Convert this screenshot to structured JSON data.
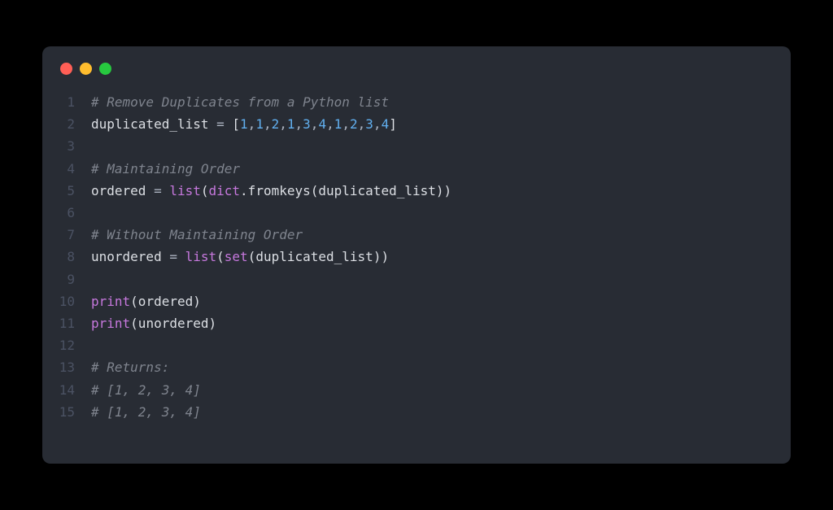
{
  "titlebar": {
    "buttons": [
      "close",
      "minimize",
      "maximize"
    ]
  },
  "code": {
    "lines": [
      {
        "num": "1",
        "tokens": [
          {
            "t": "# Remove Duplicates from a Python list",
            "c": "tk-comment"
          }
        ]
      },
      {
        "num": "2",
        "tokens": [
          {
            "t": "duplicated_list ",
            "c": "tk-white"
          },
          {
            "t": "=",
            "c": "tk-operator"
          },
          {
            "t": " [",
            "c": "tk-white"
          },
          {
            "t": "1",
            "c": "tk-number"
          },
          {
            "t": ",",
            "c": "tk-punct"
          },
          {
            "t": "1",
            "c": "tk-number"
          },
          {
            "t": ",",
            "c": "tk-punct"
          },
          {
            "t": "2",
            "c": "tk-number"
          },
          {
            "t": ",",
            "c": "tk-punct"
          },
          {
            "t": "1",
            "c": "tk-number"
          },
          {
            "t": ",",
            "c": "tk-punct"
          },
          {
            "t": "3",
            "c": "tk-number"
          },
          {
            "t": ",",
            "c": "tk-punct"
          },
          {
            "t": "4",
            "c": "tk-number"
          },
          {
            "t": ",",
            "c": "tk-punct"
          },
          {
            "t": "1",
            "c": "tk-number"
          },
          {
            "t": ",",
            "c": "tk-punct"
          },
          {
            "t": "2",
            "c": "tk-number"
          },
          {
            "t": ",",
            "c": "tk-punct"
          },
          {
            "t": "3",
            "c": "tk-number"
          },
          {
            "t": ",",
            "c": "tk-punct"
          },
          {
            "t": "4",
            "c": "tk-number"
          },
          {
            "t": "]",
            "c": "tk-white"
          }
        ]
      },
      {
        "num": "3",
        "tokens": []
      },
      {
        "num": "4",
        "tokens": [
          {
            "t": "# Maintaining Order",
            "c": "tk-comment"
          }
        ]
      },
      {
        "num": "5",
        "tokens": [
          {
            "t": "ordered ",
            "c": "tk-white"
          },
          {
            "t": "=",
            "c": "tk-operator"
          },
          {
            "t": " ",
            "c": "tk-white"
          },
          {
            "t": "list",
            "c": "tk-builtin"
          },
          {
            "t": "(",
            "c": "tk-white"
          },
          {
            "t": "dict",
            "c": "tk-builtin"
          },
          {
            "t": ".fromkeys(duplicated_list))",
            "c": "tk-white"
          }
        ]
      },
      {
        "num": "6",
        "tokens": []
      },
      {
        "num": "7",
        "tokens": [
          {
            "t": "# Without Maintaining Order",
            "c": "tk-comment"
          }
        ]
      },
      {
        "num": "8",
        "tokens": [
          {
            "t": "unordered ",
            "c": "tk-white"
          },
          {
            "t": "=",
            "c": "tk-operator"
          },
          {
            "t": " ",
            "c": "tk-white"
          },
          {
            "t": "list",
            "c": "tk-builtin"
          },
          {
            "t": "(",
            "c": "tk-white"
          },
          {
            "t": "set",
            "c": "tk-builtin"
          },
          {
            "t": "(duplicated_list))",
            "c": "tk-white"
          }
        ]
      },
      {
        "num": "9",
        "tokens": []
      },
      {
        "num": "10",
        "tokens": [
          {
            "t": "print",
            "c": "tk-builtin"
          },
          {
            "t": "(ordered)",
            "c": "tk-white"
          }
        ]
      },
      {
        "num": "11",
        "tokens": [
          {
            "t": "print",
            "c": "tk-builtin"
          },
          {
            "t": "(unordered)",
            "c": "tk-white"
          }
        ]
      },
      {
        "num": "12",
        "tokens": []
      },
      {
        "num": "13",
        "tokens": [
          {
            "t": "# Returns:",
            "c": "tk-comment"
          }
        ]
      },
      {
        "num": "14",
        "tokens": [
          {
            "t": "# [1, 2, 3, 4]",
            "c": "tk-comment"
          }
        ]
      },
      {
        "num": "15",
        "tokens": [
          {
            "t": "# [1, 2, 3, 4]",
            "c": "tk-comment"
          }
        ]
      }
    ]
  }
}
